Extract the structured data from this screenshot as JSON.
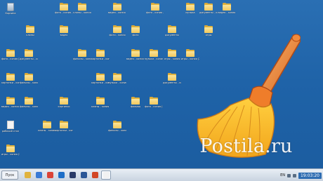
{
  "desktop": {
    "icons": [
      {
        "label": "Корзина",
        "kind": "trash"
      },
      {
        "label": "фото - копия - копия",
        "kind": "folder"
      },
      {
        "label": "клипы - копия",
        "kind": "folder"
      },
      {
        "label": "видео - копия - копия",
        "kind": "folder"
      },
      {
        "label": "фото - копия - копия (2)",
        "kind": "folder"
      },
      {
        "label": "музыка",
        "kind": "folder"
      },
      {
        "label": "документы - копия",
        "kind": "folder"
      },
      {
        "label": "видео - копия",
        "kind": "folder"
      },
      {
        "label": "клипы",
        "kind": "folder"
      },
      {
        "label": "видео",
        "kind": "folder"
      },
      {
        "label": "фото - копия",
        "kind": "folder"
      },
      {
        "label": "фото",
        "kind": "folder"
      },
      {
        "label": "документы",
        "kind": "folder"
      },
      {
        "label": "игры",
        "kind": "folder"
      },
      {
        "label": "фото - копия (2)",
        "kind": "folder"
      },
      {
        "label": "документы - копия (2)",
        "kind": "folder"
      },
      {
        "label": "фильмы - копия",
        "kind": "folder"
      },
      {
        "label": "картинки - копия (2)",
        "kind": "folder"
      },
      {
        "label": "видео - копия (2)",
        "kind": "folder"
      },
      {
        "label": "музыка - копия (2)",
        "kind": "folder"
      },
      {
        "label": "игры - копия",
        "kind": "folder"
      },
      {
        "label": "игры - копия (2)",
        "kind": "folder"
      },
      {
        "label": "картинки - копия (2)",
        "kind": "folder"
      },
      {
        "label": "фильмы - копия (2)",
        "kind": "folder"
      },
      {
        "label": "картинки - копия",
        "kind": "folder"
      },
      {
        "label": "музыка - копия",
        "kind": "folder"
      },
      {
        "label": "документы - копия (3)",
        "kind": "folder"
      },
      {
        "label": "видео - копия - копия",
        "kind": "folder"
      },
      {
        "label": "фильмы - копия - копия",
        "kind": "folder"
      },
      {
        "label": "картинки",
        "kind": "folder"
      },
      {
        "label": "клипы - копия (2)",
        "kind": "folder"
      },
      {
        "label": "фильмы",
        "kind": "folder"
      },
      {
        "label": "фото - копия (3)",
        "kind": "folder"
      },
      {
        "label": "рабочий стол",
        "kind": "doc"
      },
      {
        "label": "клипы - копия (3)",
        "kind": "folder"
      },
      {
        "label": "картинки - копия (3)",
        "kind": "folder"
      },
      {
        "label": "фильмы - копия (3)",
        "kind": "folder"
      },
      {
        "label": "игры - копия (3)",
        "kind": "folder"
      }
    ]
  },
  "watermark": {
    "text": "Postila.ru"
  },
  "taskbar": {
    "start_label": "Пуск",
    "buttons": [
      {
        "name": "explorer",
        "color": "#e0b33e"
      },
      {
        "name": "ie",
        "color": "#3a7bd5"
      },
      {
        "name": "chrome",
        "color": "#db4437"
      },
      {
        "name": "outlook",
        "color": "#1e6fc8"
      },
      {
        "name": "photoshop",
        "color": "#2a3b68"
      },
      {
        "name": "word",
        "color": "#2b5797"
      },
      {
        "name": "powerpoint",
        "color": "#d24726"
      },
      {
        "name": "paint",
        "color": "#f2f2f2"
      }
    ],
    "lang": "EN",
    "time": "19:03:20"
  }
}
